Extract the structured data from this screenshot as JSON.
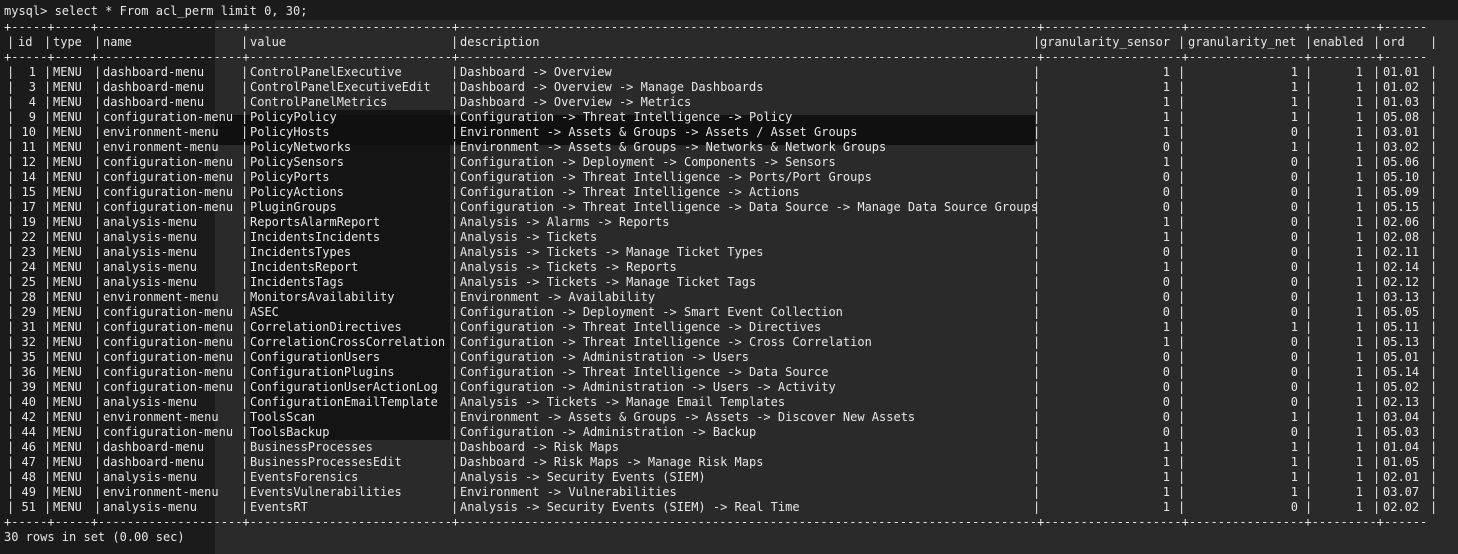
{
  "prompt": "mysql> select * From acl_perm limit 0, 30;",
  "columns": [
    "id",
    "type",
    "name",
    "value",
    "description",
    "granularity_sensor",
    "granularity_net",
    "enabled",
    "ord"
  ],
  "rows": [
    [
      "1",
      "MENU",
      "dashboard-menu",
      "ControlPanelExecutive",
      "Dashboard -> Overview",
      "1",
      "1",
      "1",
      "01.01"
    ],
    [
      "3",
      "MENU",
      "dashboard-menu",
      "ControlPanelExecutiveEdit",
      "Dashboard -> Overview -> Manage Dashboards",
      "1",
      "1",
      "1",
      "01.02"
    ],
    [
      "4",
      "MENU",
      "dashboard-menu",
      "ControlPanelMetrics",
      "Dashboard -> Overview -> Metrics",
      "1",
      "1",
      "1",
      "01.03"
    ],
    [
      "9",
      "MENU",
      "configuration-menu",
      "PolicyPolicy",
      "Configuration -> Threat Intelligence -> Policy",
      "1",
      "1",
      "1",
      "05.08"
    ],
    [
      "10",
      "MENU",
      "environment-menu",
      "PolicyHosts",
      "Environment -> Assets & Groups -> Assets / Asset Groups",
      "1",
      "0",
      "1",
      "03.01"
    ],
    [
      "11",
      "MENU",
      "environment-menu",
      "PolicyNetworks",
      "Environment -> Assets & Groups -> Networks & Network Groups",
      "0",
      "1",
      "1",
      "03.02"
    ],
    [
      "12",
      "MENU",
      "configuration-menu",
      "PolicySensors",
      "Configuration -> Deployment -> Components -> Sensors",
      "1",
      "0",
      "1",
      "05.06"
    ],
    [
      "14",
      "MENU",
      "configuration-menu",
      "PolicyPorts",
      "Configuration -> Threat Intelligence -> Ports/Port Groups",
      "0",
      "0",
      "1",
      "05.10"
    ],
    [
      "15",
      "MENU",
      "configuration-menu",
      "PolicyActions",
      "Configuration -> Threat Intelligence -> Actions",
      "0",
      "0",
      "1",
      "05.09"
    ],
    [
      "17",
      "MENU",
      "configuration-menu",
      "PluginGroups",
      "Configuration -> Threat Intelligence -> Data Source -> Manage Data Source Groups",
      "0",
      "0",
      "1",
      "05.15"
    ],
    [
      "19",
      "MENU",
      "analysis-menu",
      "ReportsAlarmReport",
      "Analysis -> Alarms -> Reports",
      "1",
      "0",
      "1",
      "02.06"
    ],
    [
      "22",
      "MENU",
      "analysis-menu",
      "IncidentsIncidents",
      "Analysis -> Tickets",
      "1",
      "0",
      "1",
      "02.08"
    ],
    [
      "23",
      "MENU",
      "analysis-menu",
      "IncidentsTypes",
      "Analysis -> Tickets -> Manage Ticket Types",
      "0",
      "0",
      "1",
      "02.11"
    ],
    [
      "24",
      "MENU",
      "analysis-menu",
      "IncidentsReport",
      "Analysis -> Tickets -> Reports",
      "1",
      "0",
      "1",
      "02.14"
    ],
    [
      "25",
      "MENU",
      "analysis-menu",
      "IncidentsTags",
      "Analysis -> Tickets -> Manage Ticket Tags",
      "0",
      "0",
      "1",
      "02.12"
    ],
    [
      "28",
      "MENU",
      "environment-menu",
      "MonitorsAvailability",
      "Environment -> Availability",
      "0",
      "0",
      "1",
      "03.13"
    ],
    [
      "29",
      "MENU",
      "configuration-menu",
      "ASEC",
      "Configuration -> Deployment -> Smart Event Collection",
      "0",
      "0",
      "1",
      "05.05"
    ],
    [
      "31",
      "MENU",
      "configuration-menu",
      "CorrelationDirectives",
      "Configuration -> Threat Intelligence -> Directives",
      "1",
      "1",
      "1",
      "05.11"
    ],
    [
      "32",
      "MENU",
      "configuration-menu",
      "CorrelationCrossCorrelation",
      "Configuration -> Threat Intelligence -> Cross Correlation",
      "1",
      "0",
      "1",
      "05.13"
    ],
    [
      "35",
      "MENU",
      "configuration-menu",
      "ConfigurationUsers",
      "Configuration -> Administration -> Users",
      "0",
      "0",
      "1",
      "05.01"
    ],
    [
      "36",
      "MENU",
      "configuration-menu",
      "ConfigurationPlugins",
      "Configuration -> Threat Intelligence -> Data Source",
      "0",
      "0",
      "1",
      "05.14"
    ],
    [
      "39",
      "MENU",
      "configuration-menu",
      "ConfigurationUserActionLog",
      "Configuration -> Administration -> Users -> Activity",
      "0",
      "0",
      "1",
      "05.02"
    ],
    [
      "40",
      "MENU",
      "analysis-menu",
      "ConfigurationEmailTemplate",
      "Analysis -> Tickets -> Manage Email Templates",
      "0",
      "0",
      "1",
      "02.13"
    ],
    [
      "42",
      "MENU",
      "environment-menu",
      "ToolsScan",
      "Environment -> Assets & Groups -> Assets -> Discover New Assets",
      "0",
      "1",
      "1",
      "03.04"
    ],
    [
      "44",
      "MENU",
      "configuration-menu",
      "ToolsBackup",
      "Configuration -> Administration -> Backup",
      "0",
      "0",
      "1",
      "05.03"
    ],
    [
      "46",
      "MENU",
      "dashboard-menu",
      "BusinessProcesses",
      "Dashboard -> Risk Maps",
      "1",
      "1",
      "1",
      "01.04"
    ],
    [
      "47",
      "MENU",
      "dashboard-menu",
      "BusinessProcessesEdit",
      "Dashboard -> Risk Maps -> Manage Risk Maps",
      "1",
      "1",
      "1",
      "01.05"
    ],
    [
      "48",
      "MENU",
      "analysis-menu",
      "EventsForensics",
      "Analysis -> Security Events (SIEM)",
      "1",
      "1",
      "1",
      "02.01"
    ],
    [
      "49",
      "MENU",
      "environment-menu",
      "EventsVulnerabilities",
      "Environment -> Vulnerabilities",
      "1",
      "1",
      "1",
      "03.07"
    ],
    [
      "51",
      "MENU",
      "analysis-menu",
      "EventsRT",
      "Analysis -> Security Events (SIEM) -> Real Time",
      "1",
      "0",
      "1",
      "02.02"
    ]
  ],
  "footer": "30 rows in set (0.00 sec)"
}
